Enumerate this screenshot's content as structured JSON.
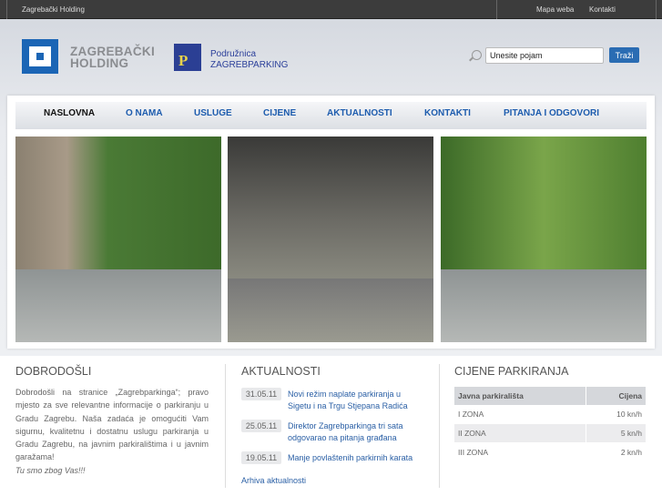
{
  "topbar": {
    "holding": "Zagrebački Holding",
    "sitemap": "Mapa weba",
    "contacts": "Kontakti"
  },
  "header": {
    "holding_line1": "ZAGREBAČKI",
    "holding_line2": "HOLDING",
    "branch_line1": "Podružnica",
    "branch_line2": "ZAGREBPARKING",
    "logo_letter": "P"
  },
  "search": {
    "placeholder": "Unesite pojam",
    "button": "Traži"
  },
  "nav": [
    "NASLOVNA",
    "O NAMA",
    "USLUGE",
    "CIJENE",
    "AKTUALNOSTI",
    "KONTAKTI",
    "PITANJA I ODGOVORI"
  ],
  "welcome": {
    "title": "DOBRODOŠLI",
    "text": "Dobrodošli na stranice „Zagrebparkinga“; pravo mjesto za sve relevantne informacije o parkiranju u Gradu Zagrebu. Naša zadaća je omogućiti Vam sigurnu, kvalitetnu i dostatnu uslugu parkiranja u Gradu Zagrebu, na javnim parkiralištima i u javnim garažama!",
    "motto": "Tu smo zbog Vas!!!"
  },
  "news": {
    "title": "AKTUALNOSTI",
    "items": [
      {
        "date": "31.05.11",
        "title": "Novi režim naplate parkiranja u Sigetu i na Trgu Stjepana Radića"
      },
      {
        "date": "25.05.11",
        "title": "Direktor Zagrebparkinga tri sata odgovarao na pitanja građana"
      },
      {
        "date": "19.05.11",
        "title": "Manje povlaštenih parkirnih karata"
      }
    ],
    "archive": "Arhiva aktualnosti"
  },
  "prices": {
    "title": "CIJENE PARKIRANJA",
    "headers": [
      "Javna parkirališta",
      "Cijena"
    ],
    "rows": [
      [
        "I ZONA",
        "10 kn/h"
      ],
      [
        "II ZONA",
        "5 kn/h"
      ],
      [
        "III ZONA",
        "2 kn/h"
      ]
    ]
  }
}
